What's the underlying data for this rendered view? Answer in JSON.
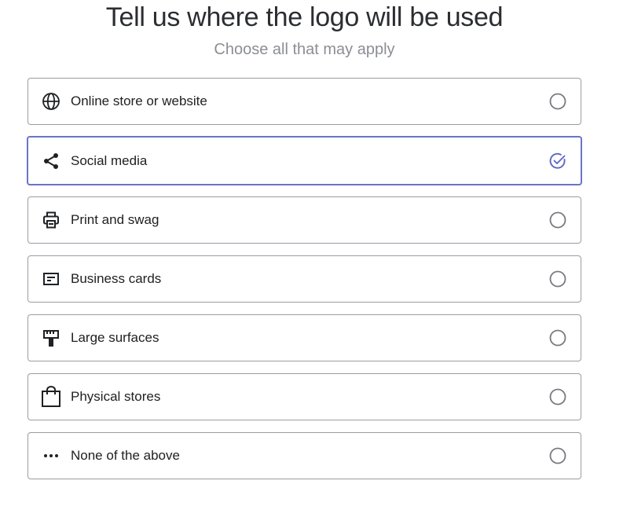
{
  "header": {
    "title": "Tell us where the logo will be used",
    "subtitle": "Choose all that may apply"
  },
  "options": [
    {
      "label": "Online store or website",
      "icon": "globe-icon",
      "selected": false
    },
    {
      "label": "Social media",
      "icon": "share-icon",
      "selected": true
    },
    {
      "label": "Print and swag",
      "icon": "printer-icon",
      "selected": false
    },
    {
      "label": "Business cards",
      "icon": "business-card-icon",
      "selected": false
    },
    {
      "label": "Large surfaces",
      "icon": "billboard-icon",
      "selected": false
    },
    {
      "label": "Physical stores",
      "icon": "shopping-bag-icon",
      "selected": false
    },
    {
      "label": "None of the above",
      "icon": "more-dots-icon",
      "selected": false
    }
  ],
  "colors": {
    "selected_border": "#6a74c9",
    "default_border": "#9a9ca1",
    "check_color": "#5c68c4"
  }
}
